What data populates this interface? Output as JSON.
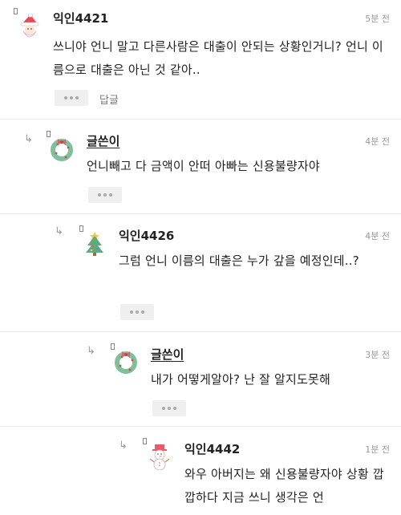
{
  "comments": [
    {
      "avatar": "santa-icon",
      "name": "익인4421",
      "time": "5분 전",
      "text": "쓰니야 언니 말고 다른사람은 대출이 안되는 상황인거니? 언니 이름으로 대출은 아닌 것 같아..",
      "reply_label": "답글"
    },
    {
      "avatar": "wreath-icon",
      "name": "글쓴이",
      "time": "4분 전",
      "text": "언니빼고 다 금액이 안떠 아빠는 신용불량자야"
    },
    {
      "avatar": "christmas-tree-icon",
      "name": "익인4426",
      "time": "4분 전",
      "text": "그럼 언니 이름의 대출은 누가 갚을 예정인데..?"
    },
    {
      "avatar": "wreath-icon",
      "name": "글쓴이",
      "time": "3분 전",
      "text": "내가 어떻게알아? 난 잘 알지도못해"
    },
    {
      "avatar": "snowman-icon",
      "name": "익인4442",
      "time": "1분 전",
      "text": "와우 아버지는 왜 신용불량자야 상황 깝깝하다 지금 쓰니 생각은 언"
    }
  ],
  "colors": {
    "text": "#222222",
    "meta": "#9a9a9a",
    "more_bg": "#efefef",
    "divider": "#ececec"
  }
}
